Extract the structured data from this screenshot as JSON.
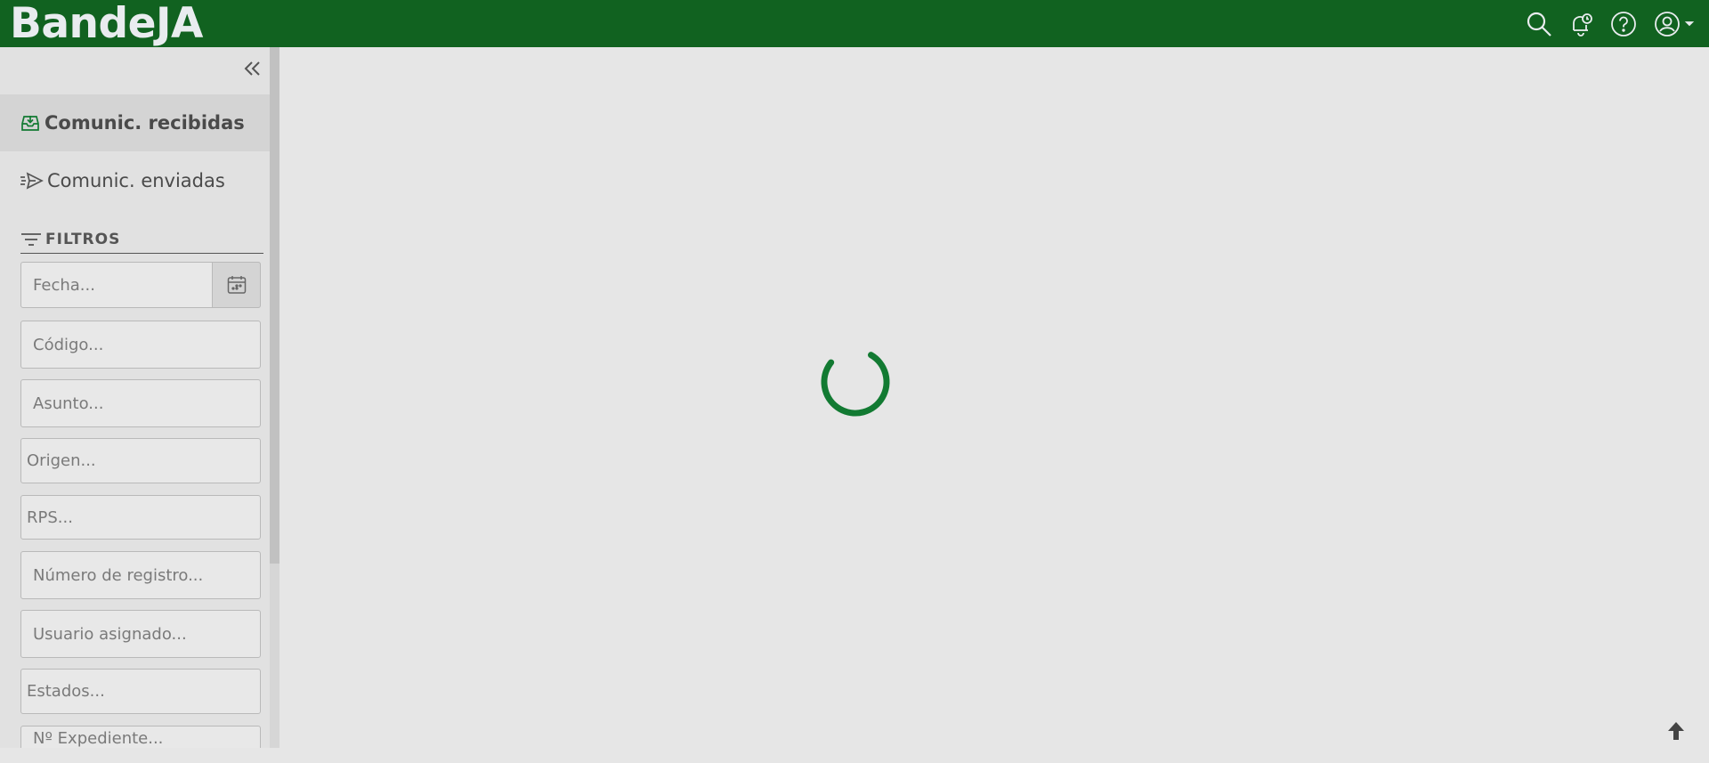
{
  "header": {
    "brand": "BandeJA",
    "icons": [
      "search-icon",
      "notification-bell-icon",
      "help-icon",
      "user-account-icon"
    ],
    "colors": {
      "header_bg": "#116220",
      "brand_text": "#e9ecef",
      "accent": "#127a32"
    }
  },
  "sidebar": {
    "nav": [
      {
        "label": "Comunic. recibidas",
        "icon": "inbox-download-icon",
        "active": true
      },
      {
        "label": "Comunic. enviadas",
        "icon": "send-icon",
        "active": false
      }
    ],
    "filters_title": "FILTROS",
    "filters": {
      "fecha": "Fecha...",
      "codigo": "Código...",
      "asunto": "Asunto...",
      "origen": "Origen...",
      "rps": "RPS...",
      "numero_registro": "Número de registro...",
      "usuario_asignado": "Usuario asignado...",
      "estados": "Estados...",
      "expediente": "Nº Expediente..."
    }
  },
  "main": {
    "loading": true
  }
}
